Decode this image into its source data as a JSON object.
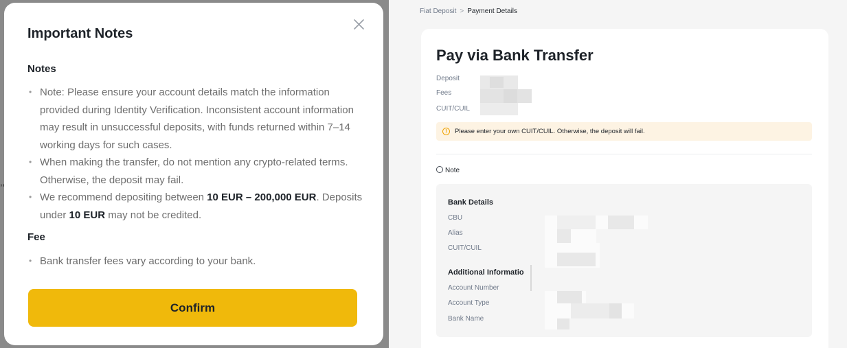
{
  "modal": {
    "title": "Important Notes",
    "close_icon": "close-icon",
    "notes_heading": "Notes",
    "notes": [
      {
        "before": "Note: Please ensure your account details match the information provided during Identity Verification. Inconsistent account information may result in unsuccessful deposits, with funds returned within 7–14 working days for such cases."
      },
      {
        "before": "When making the transfer, do not mention any crypto-related terms. Otherwise, the deposit may fail."
      },
      {
        "before": "We recommend depositing between ",
        "bold1": "10 EUR – 200,000 EUR",
        "middle": ". Deposits under ",
        "bold2": "10 EUR",
        "after": " may not be credited."
      }
    ],
    "fee_heading": "Fee",
    "fee_items": [
      "Bank transfer fees vary according to your bank."
    ],
    "confirm_label": "Confirm"
  },
  "breadcrumb": {
    "parent": "Fiat Deposit",
    "separator": ">",
    "current": "Payment Details"
  },
  "payment": {
    "title": "Pay via Bank Transfer",
    "deposit_label": "Deposit",
    "fees_label": "Fees",
    "cuit_label": "CUIT/CUIL",
    "warning_icon": "warning-icon",
    "warning_text": "Please enter your own CUIT/CUIL. Otherwise, the deposit will fail.",
    "note_label": "Note",
    "bank_details": {
      "heading": "Bank Details",
      "cbu_label": "CBU",
      "alias_label": "Alias",
      "cuit_label": "CUIT/CUIL"
    },
    "additional": {
      "heading": "Additional Informatio",
      "account_number_label": "Account Number",
      "account_type_label": "Account Type",
      "bank_name_label": "Bank Name"
    }
  },
  "colors": {
    "accent": "#f0b90b",
    "warning_bg": "#fdf3e3",
    "warning_icon": "#f0a300"
  }
}
